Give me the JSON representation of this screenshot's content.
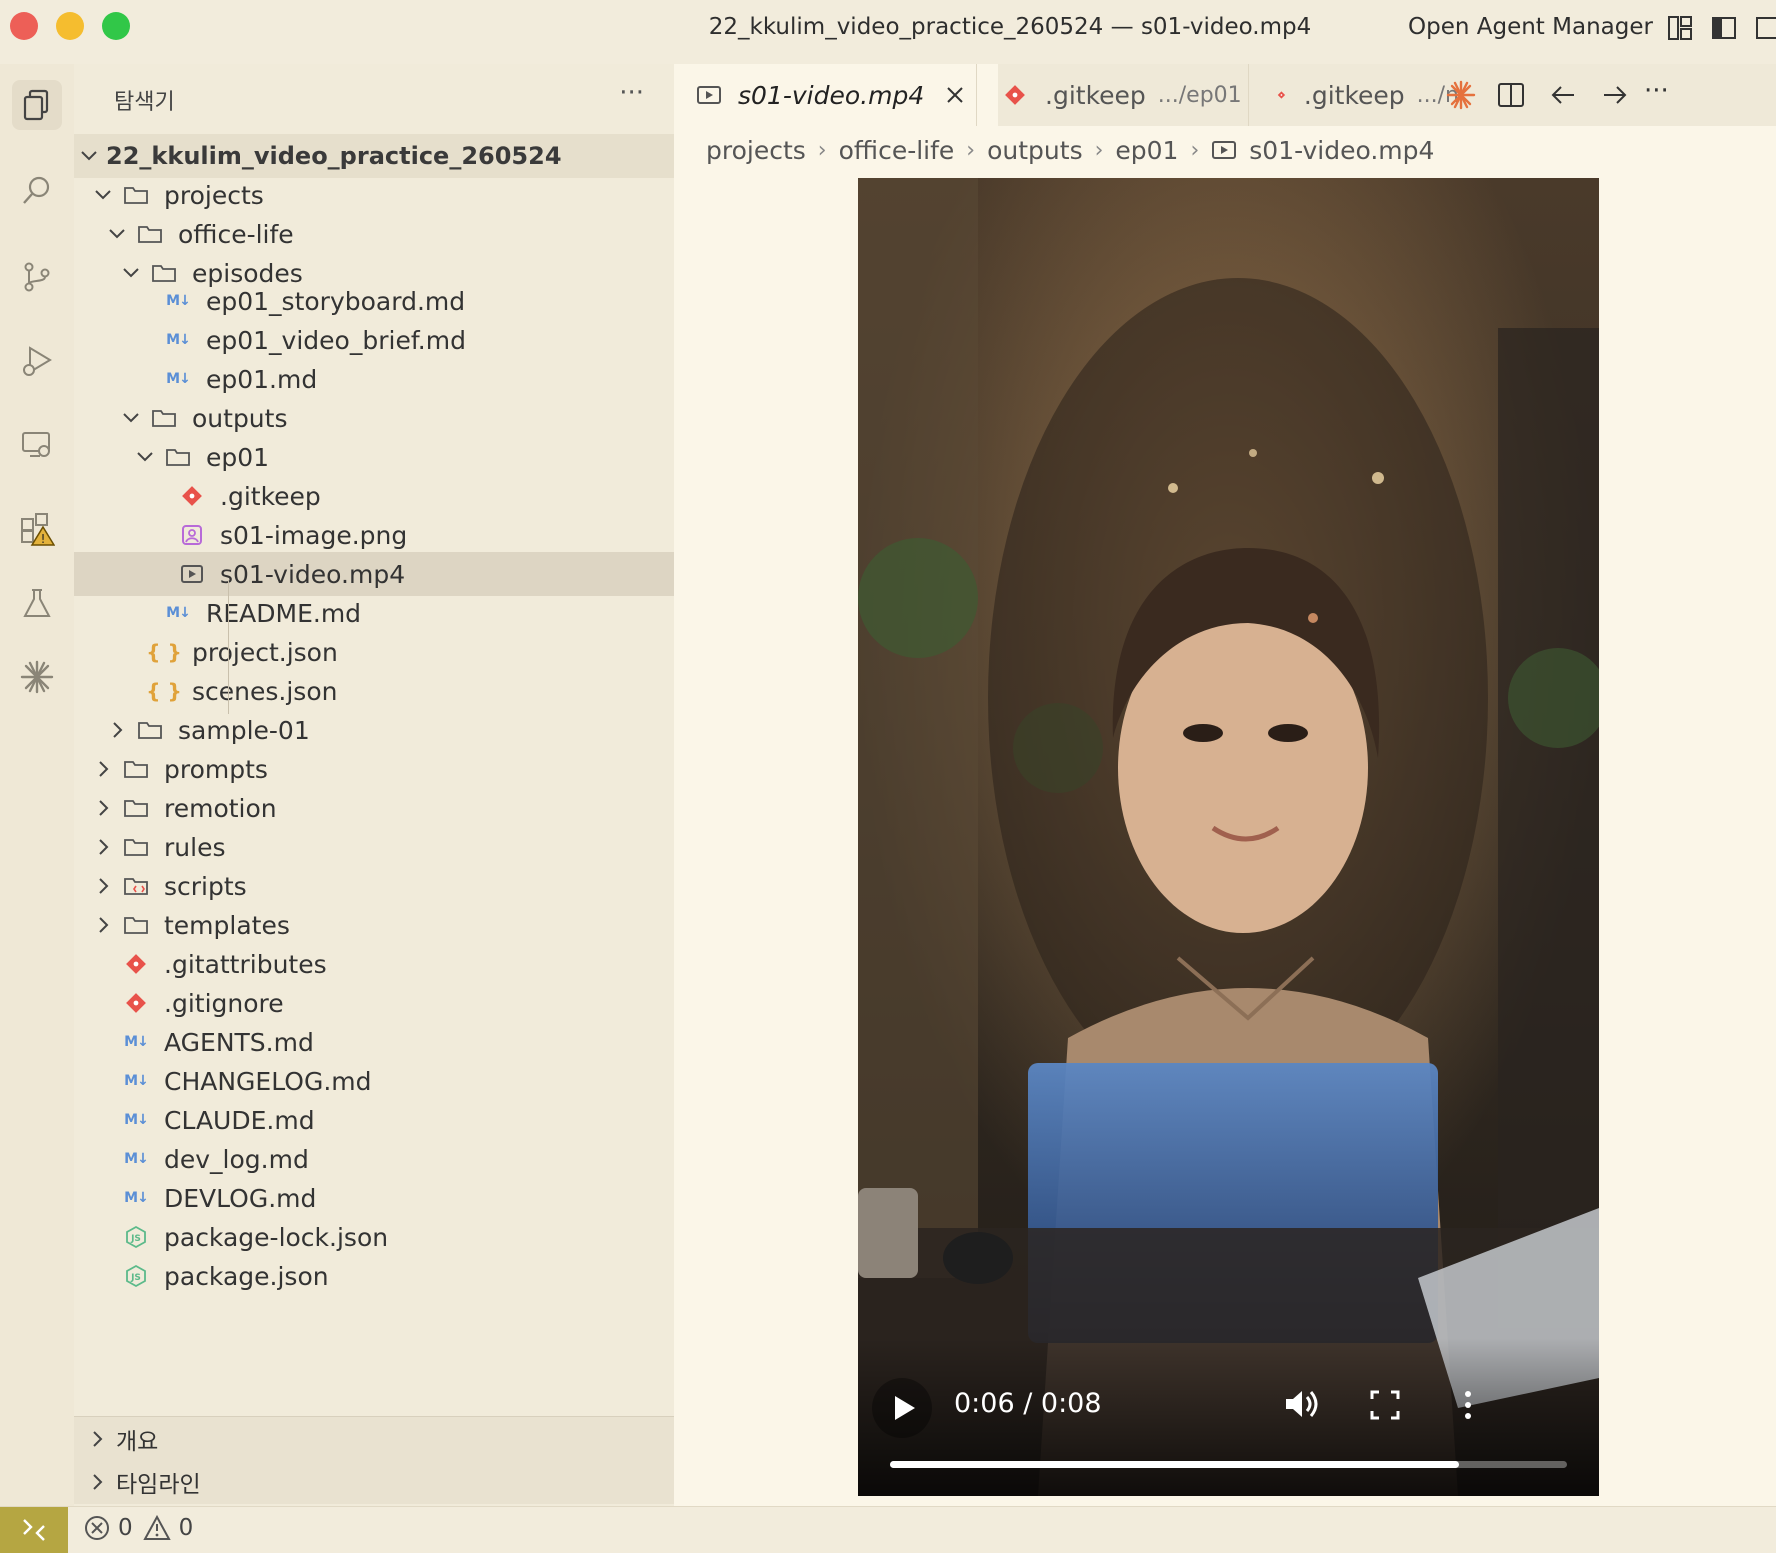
{
  "window": {
    "title": "22_kkulim_video_practice_260524 — s01-video.mp4",
    "agent_manager": "Open Agent Manager"
  },
  "sidebar": {
    "header": "탐색기",
    "more": "···",
    "root": "22_kkulim_video_practice_260524",
    "items": [
      {
        "label": "projects"
      },
      {
        "label": "office-life"
      },
      {
        "label": "episodes"
      },
      {
        "label": "ep01_storyboard.md"
      },
      {
        "label": "ep01_video_brief.md"
      },
      {
        "label": "ep01.md"
      },
      {
        "label": "outputs"
      },
      {
        "label": "ep01"
      },
      {
        "label": ".gitkeep"
      },
      {
        "label": "s01-image.png"
      },
      {
        "label": "s01-video.mp4"
      },
      {
        "label": "README.md"
      },
      {
        "label": "project.json"
      },
      {
        "label": "scenes.json"
      },
      {
        "label": "sample-01"
      },
      {
        "label": "prompts"
      },
      {
        "label": "remotion"
      },
      {
        "label": "rules"
      },
      {
        "label": "scripts"
      },
      {
        "label": "templates"
      },
      {
        "label": ".gitattributes"
      },
      {
        "label": ".gitignore"
      },
      {
        "label": "AGENTS.md"
      },
      {
        "label": "CHANGELOG.md"
      },
      {
        "label": "CLAUDE.md"
      },
      {
        "label": "dev_log.md"
      },
      {
        "label": "DEVLOG.md"
      },
      {
        "label": "package-lock.json"
      },
      {
        "label": "package.json"
      }
    ],
    "md_badge": "M↓",
    "json_badge": "{ }",
    "outline": "개요",
    "timeline": "타임라인"
  },
  "tabs": [
    {
      "label": "s01-video.mp4",
      "active": true
    },
    {
      "label": ".gitkeep",
      "description": ".../ep01"
    },
    {
      "label": ".gitkeep",
      "description": ".../n"
    }
  ],
  "tab_actions": {
    "more": "···"
  },
  "breadcrumb": [
    "projects",
    "office-life",
    "outputs",
    "ep01",
    "s01-video.mp4"
  ],
  "video": {
    "time": "0:06 / 0:08",
    "progress": 0.84
  },
  "statusbar": {
    "errors": "0",
    "warnings": "0"
  },
  "colors": {
    "accent_remote": "#b5a642",
    "git_red": "#e8524a",
    "selected_row": "#ddd5c3"
  }
}
